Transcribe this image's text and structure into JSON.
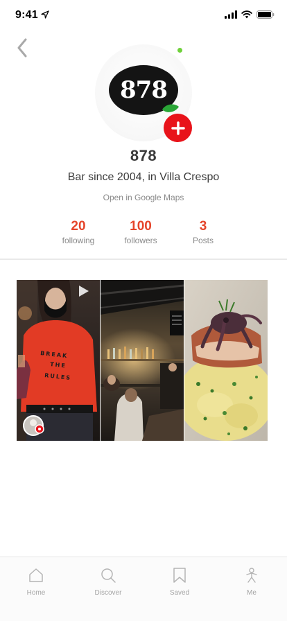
{
  "status_bar": {
    "time": "9:41"
  },
  "profile": {
    "logo_text": "878",
    "name": "878",
    "bio": "Bar since 2004, in Villa Crespo",
    "maps_link": "Open in Google Maps",
    "online": true
  },
  "stats": [
    {
      "value": "20",
      "label": "following"
    },
    {
      "value": "100",
      "label": "followers"
    },
    {
      "value": "3",
      "label": "Posts"
    }
  ],
  "posts": [
    {
      "kind": "video",
      "shirt_text": "BREAK THE RULES"
    },
    {
      "kind": "photo"
    },
    {
      "kind": "photo"
    }
  ],
  "tabbar": [
    {
      "label": "Home",
      "icon": "home-icon"
    },
    {
      "label": "Discover",
      "icon": "search-icon"
    },
    {
      "label": "Saved",
      "icon": "bookmark-icon"
    },
    {
      "label": "Me",
      "icon": "person-icon"
    }
  ],
  "colors": {
    "accent": "#e5452b",
    "follow_button": "#e8131a",
    "online_dot": "#6fd13b"
  }
}
